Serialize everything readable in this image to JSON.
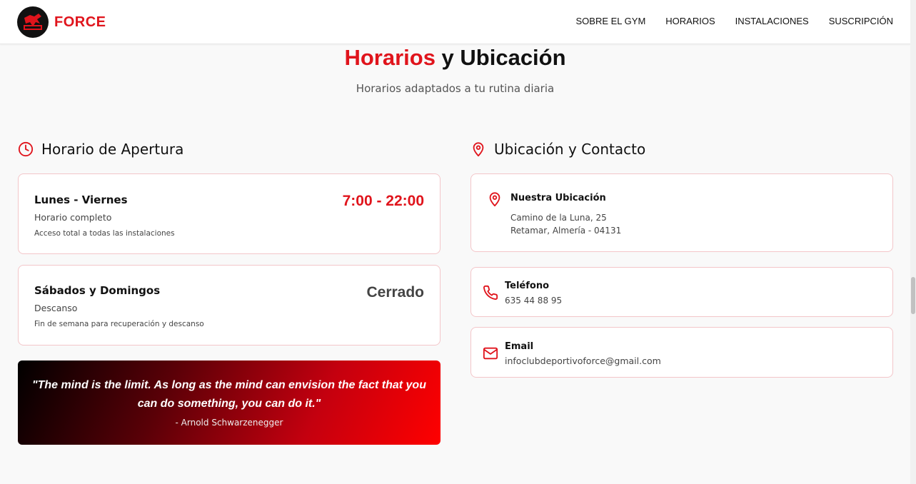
{
  "header": {
    "brand": "FORCE",
    "nav": [
      "SOBRE EL GYM",
      "HORARIOS",
      "INSTALACIONES",
      "SUSCRIPCIÓN"
    ]
  },
  "section": {
    "title_accent": "Horarios",
    "title_rest": " y Ubicación",
    "subtitle": "Horarios adaptados a tu rutina diaria"
  },
  "opening": {
    "heading": "Horario de Apertura",
    "weekdays": {
      "title": "Lunes - Viernes",
      "sub": "Horario completo",
      "note": "Acceso total a todas las instalaciones",
      "hours": "7:00 - 22:00"
    },
    "weekend": {
      "title": "Sábados y Domingos",
      "sub": "Descanso",
      "note": "Fin de semana para recuperación y descanso",
      "hours": "Cerrado"
    },
    "quote": {
      "text": "\"The mind is the limit. As long as the mind can envision the fact that you can do something, you can do it.\"",
      "author": "- Arnold Schwarzenegger"
    }
  },
  "contact": {
    "heading": "Ubicación y Contacto",
    "location": {
      "label": "Nuestra Ubicación",
      "line1": "Camino de la Luna, 25",
      "line2": "Retamar, Almería - 04131"
    },
    "phone": {
      "label": "Teléfono",
      "value": "635 44 88 95"
    },
    "email": {
      "label": "Email",
      "value": "infoclubdeportivoforce@gmail.com"
    }
  },
  "colors": {
    "accent": "#e0141c",
    "card_border": "#f3c6c9",
    "closed": "#444444"
  }
}
